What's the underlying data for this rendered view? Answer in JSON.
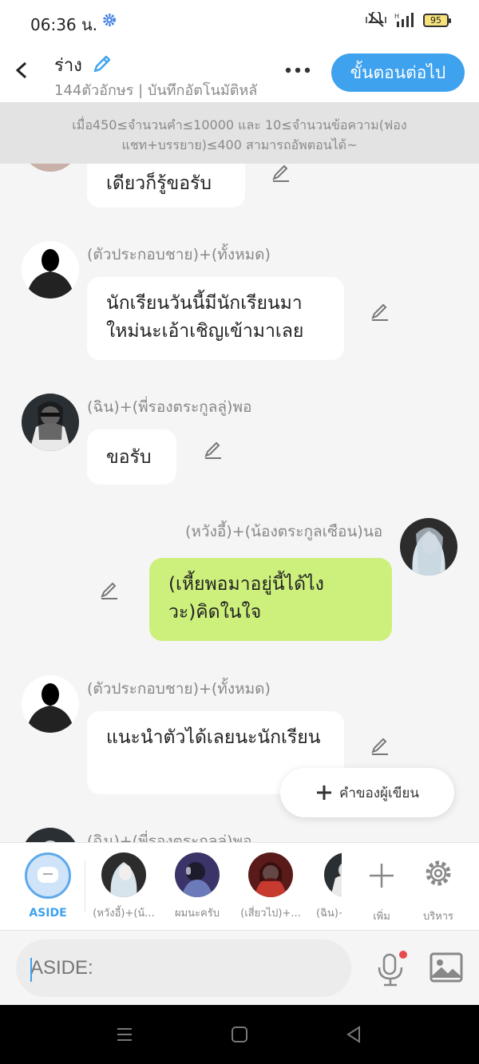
{
  "status": {
    "time": "06:36 น.",
    "battery": "95"
  },
  "header": {
    "title": "ร่าง",
    "subtitle": "144ตัวอักษร | บันทึกอัตโนมัติหลั",
    "next_label": "ขั้นตอนต่อไป"
  },
  "notice": "เมื่อ450≤จำนวนคำ≤10000 และ 10≤จำนวนข้อความ(ฟองแชท+บรรยาย)≤400 สามารถอัพตอนได้~",
  "messages": [
    {
      "name": "",
      "text": "เดียวก็รู้ขอรับ"
    },
    {
      "name": "(ตัวประกอบชาย)+(ทั้งหมด)",
      "text": "นักเรียนวันนี้มีนักเรียนมาใหม่นะเอ้าเชิญเข้ามาเลย"
    },
    {
      "name": "(ฉิน)+(พี่รองตระกูลลู่)พอ",
      "text": "ขอรับ"
    },
    {
      "name": "(หวังอี้)+(น้องตระกูลเซือน)นอ",
      "text": "(เหี้ยพอมาอยู่นี้ได้ไงวะ)คิดในใจ"
    },
    {
      "name": "(ตัวประกอบชาย)+(ทั้งหมด)",
      "text": "แนะนำตัวได้เลยนะนักเรียน"
    },
    {
      "name": "(ฉิน)+(พี่รองตระกูลลู่)พอ",
      "text": ""
    }
  ],
  "author_button": "คำของผู้เขียน",
  "characters": [
    {
      "label": "ASIDE"
    },
    {
      "label": "(หวังอี้)+(น้..."
    },
    {
      "label": "ผมนะครับ"
    },
    {
      "label": "(เสี่ยวไป)+..."
    },
    {
      "label": "(ฉิน)+"
    }
  ],
  "actions": {
    "add_label": "เพิ่ม",
    "manage_label": "บริหาร"
  },
  "input": {
    "placeholder": "ASIDE:"
  },
  "colors": {
    "accent": "#3ea2ee",
    "my_bubble": "#cdf07d",
    "notice_bg": "#e3e3e3"
  }
}
